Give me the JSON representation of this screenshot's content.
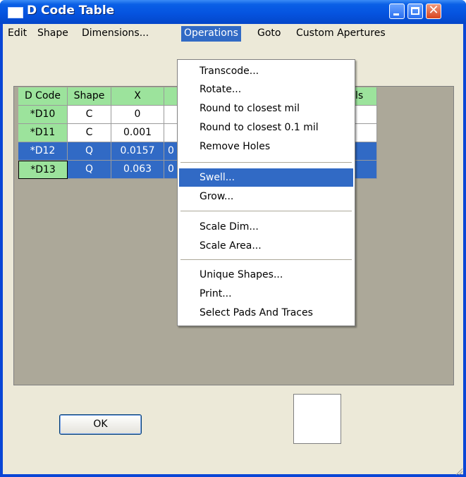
{
  "window": {
    "title": "D Code Table"
  },
  "menubar": {
    "items": [
      "Edit",
      "Shape",
      "Dimensions...",
      "Operations",
      "Goto",
      "Custom Apertures"
    ],
    "active": "Operations"
  },
  "table": {
    "headers": [
      "D Code",
      "Shape",
      "X",
      "",
      "ls"
    ],
    "rows": [
      {
        "dcode": "*D10",
        "shape": "C",
        "x": "0",
        "y": "",
        "selected": false
      },
      {
        "dcode": "*D11",
        "shape": "C",
        "x": "0.001",
        "y": "",
        "selected": false
      },
      {
        "dcode": "*D12",
        "shape": "Q",
        "x": "0.0157",
        "y": "0",
        "selected": true
      },
      {
        "dcode": "*D13",
        "shape": "Q",
        "x": "0.063",
        "y": "0",
        "selected": true
      }
    ]
  },
  "operations_menu": {
    "items": [
      "Transcode...",
      "Rotate...",
      "Round to closest mil",
      "Round to closest 0.1 mil",
      "Remove Holes",
      "Swell...",
      "Grow...",
      "Scale Dim...",
      "Scale Area...",
      "Unique Shapes...",
      "Print...",
      "Select Pads And Traces"
    ],
    "highlighted": "Swell..."
  },
  "buttons": {
    "ok_label": "OK"
  },
  "colors": {
    "title_blue": "#0a5fe6",
    "highlight": "#316ac5",
    "header_green": "#9ce39c",
    "grid_bg": "#aca899"
  }
}
